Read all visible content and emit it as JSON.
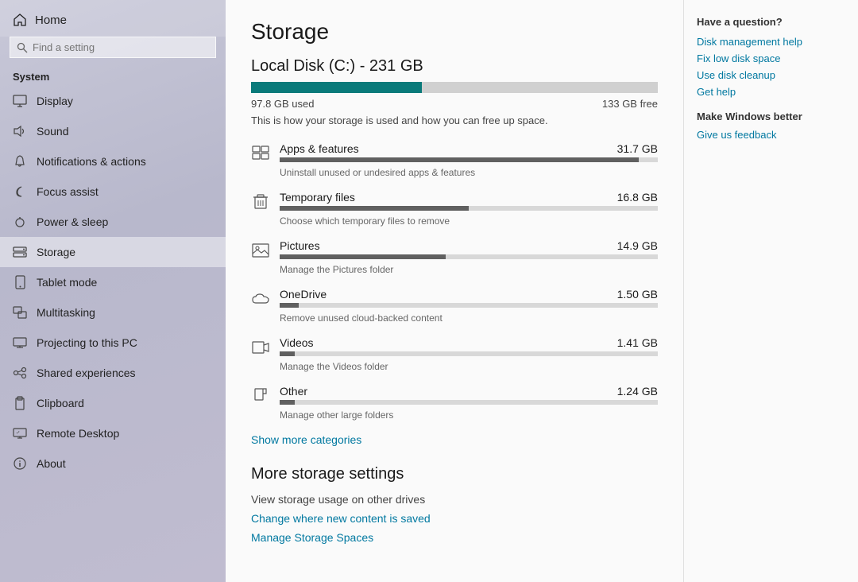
{
  "sidebar": {
    "home_label": "Home",
    "search_placeholder": "Find a setting",
    "system_label": "System",
    "items": [
      {
        "id": "display",
        "label": "Display",
        "icon": "monitor"
      },
      {
        "id": "sound",
        "label": "Sound",
        "icon": "sound"
      },
      {
        "id": "notifications",
        "label": "Notifications & actions",
        "icon": "bell"
      },
      {
        "id": "focus",
        "label": "Focus assist",
        "icon": "moon"
      },
      {
        "id": "power",
        "label": "Power & sleep",
        "icon": "power"
      },
      {
        "id": "storage",
        "label": "Storage",
        "icon": "storage"
      },
      {
        "id": "tablet",
        "label": "Tablet mode",
        "icon": "tablet"
      },
      {
        "id": "multitasking",
        "label": "Multitasking",
        "icon": "multitask"
      },
      {
        "id": "projecting",
        "label": "Projecting to this PC",
        "icon": "project"
      },
      {
        "id": "shared",
        "label": "Shared experiences",
        "icon": "shared"
      },
      {
        "id": "clipboard",
        "label": "Clipboard",
        "icon": "clipboard"
      },
      {
        "id": "remote",
        "label": "Remote Desktop",
        "icon": "remote"
      },
      {
        "id": "about",
        "label": "About",
        "icon": "info"
      }
    ]
  },
  "main": {
    "page_title": "Storage",
    "disk_title": "Local Disk (C:) - 231 GB",
    "used_label": "97.8 GB used",
    "free_label": "133 GB free",
    "used_percent": 42,
    "description": "This is how your storage is used and how you can free up space.",
    "items": [
      {
        "name": "Apps & features",
        "size": "31.7 GB",
        "desc": "Uninstall unused or undesired apps & features",
        "percent": 95,
        "icon": "apps"
      },
      {
        "name": "Temporary files",
        "size": "16.8 GB",
        "desc": "Choose which temporary files to remove",
        "percent": 50,
        "icon": "trash"
      },
      {
        "name": "Pictures",
        "size": "14.9 GB",
        "desc": "Manage the Pictures folder",
        "percent": 44,
        "icon": "pictures"
      },
      {
        "name": "OneDrive",
        "size": "1.50 GB",
        "desc": "Remove unused cloud-backed content",
        "percent": 5,
        "icon": "cloud"
      },
      {
        "name": "Videos",
        "size": "1.41 GB",
        "desc": "Manage the Videos folder",
        "percent": 4,
        "icon": "video"
      },
      {
        "name": "Other",
        "size": "1.24 GB",
        "desc": "Manage other large folders",
        "percent": 4,
        "icon": "other"
      }
    ],
    "show_more": "Show more categories",
    "more_settings_title": "More storage settings",
    "other_drives_label": "View storage usage on other drives",
    "change_content_label": "Change where new content is saved",
    "manage_spaces_label": "Manage Storage Spaces"
  },
  "right": {
    "question": "Have a question?",
    "links": [
      "Disk management help",
      "Fix low disk space",
      "Use disk cleanup",
      "Get help"
    ],
    "make_better": "Make Windows better",
    "feedback": "Give us feedback"
  }
}
